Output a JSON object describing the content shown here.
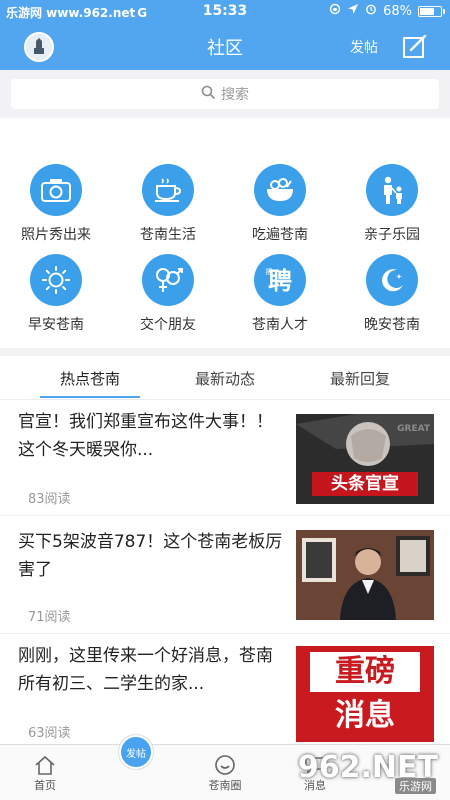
{
  "status_bar": {
    "carrier": "乐游网 www.962.net",
    "carrier_suffix": "G",
    "time": "15:33",
    "battery_percent": "68%",
    "battery_level": 0.68
  },
  "header": {
    "title": "社区",
    "post_label": "发帖",
    "avatar_icon": "user-avatar-icon",
    "edit_icon": "edit-icon"
  },
  "search": {
    "placeholder": "搜索"
  },
  "categories": [
    {
      "label": "照片秀出来",
      "icon": "camera-icon"
    },
    {
      "label": "苍南生活",
      "icon": "coffee-cup-icon"
    },
    {
      "label": "吃遍苍南",
      "icon": "salad-bowl-icon"
    },
    {
      "label": "亲子乐园",
      "icon": "parent-child-icon"
    },
    {
      "label": "早安苍南",
      "icon": "sun-icon"
    },
    {
      "label": "交个朋友",
      "icon": "gender-icon"
    },
    {
      "label": "苍南人才",
      "icon": "recruit-icon"
    },
    {
      "label": "晚安苍南",
      "icon": "moon-icon"
    }
  ],
  "tabs": [
    {
      "label": "热点苍南",
      "active": true
    },
    {
      "label": "最新动态",
      "active": false
    },
    {
      "label": "最新回复",
      "active": false
    }
  ],
  "articles": [
    {
      "title": "官宣！我们郑重宣布这件大事！！这个冬天暖哭你...",
      "reads": "83阅读",
      "thumb_text": "头条官宣",
      "thumb_badge": "GREAT"
    },
    {
      "title": "买下5架波音787！这个苍南老板厉害了",
      "reads": "71阅读"
    },
    {
      "title": "刚刚，这里传来一个好消息，苍南所有初三、二学生的家...",
      "reads": "63阅读",
      "thumb_line1": "重磅",
      "thumb_line2": "消息"
    }
  ],
  "bottom_nav": {
    "home_label": "首页",
    "post_label": "发帖",
    "circle_label": "苍南圈",
    "message_label": "消息"
  },
  "watermark": {
    "text": "962.NET",
    "subtext": "乐游网"
  },
  "colors": {
    "brand_blue": "#52a6ef",
    "icon_blue": "#3c9fe9"
  }
}
